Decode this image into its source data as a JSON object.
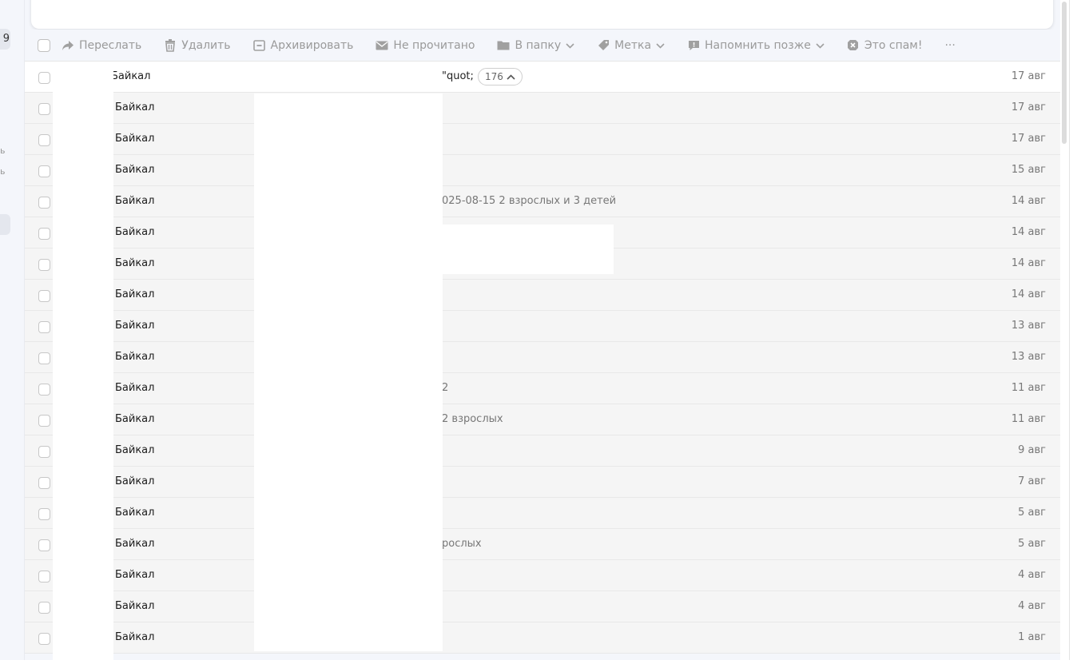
{
  "rail": {
    "badge": "9",
    "mark1": "ь",
    "mark2": "ь"
  },
  "toolbar": {
    "forward": "Переслать",
    "delete": "Удалить",
    "archive": "Архивировать",
    "unread": "Не прочитано",
    "folder": "В папку",
    "label": "Метка",
    "remind": "Напомнить позже",
    "spam": "Это спам!",
    "more": "···"
  },
  "messages": [
    {
      "sender": "Байкал",
      "subject": "\"quot;",
      "date": "17 авг",
      "thread_count": "176"
    },
    {
      "sender": "Байкал",
      "subject": "",
      "date": "17 авг"
    },
    {
      "sender": "Байкал",
      "subject": "",
      "date": "17 авг"
    },
    {
      "sender": "Байкал",
      "subject": "",
      "date": "15 авг"
    },
    {
      "sender": "Байкал",
      "subject": "025-08-15 2 взрослых и 3 детей",
      "date": "14 авг"
    },
    {
      "sender": "Байкал",
      "subject": "",
      "date": "14 авг"
    },
    {
      "sender": "Байкал",
      "subject": "",
      "date": "14 авг"
    },
    {
      "sender": "Байкал",
      "subject": "",
      "date": "14 авг"
    },
    {
      "sender": "Байкал",
      "subject": "",
      "date": "13 авг"
    },
    {
      "sender": "Байкал",
      "subject": "",
      "date": "13 авг"
    },
    {
      "sender": "Байкал",
      "subject": "2",
      "date": "11 авг"
    },
    {
      "sender": "Байкал",
      "subject": "2 взрослых",
      "date": "11 авг"
    },
    {
      "sender": "Байкал",
      "subject": "",
      "date": "9 авг"
    },
    {
      "sender": "Байкал",
      "subject": "",
      "date": "7 авг"
    },
    {
      "sender": "Байкал",
      "subject": "",
      "date": "5 авг"
    },
    {
      "sender": "Байкал",
      "subject": "рослых",
      "date": "5 авг"
    },
    {
      "sender": "Байкал",
      "subject": "",
      "date": "4 авг"
    },
    {
      "sender": "Байкал",
      "subject": "",
      "date": "4 авг"
    },
    {
      "sender": "Байкал",
      "subject": "",
      "date": "1 авг"
    }
  ]
}
